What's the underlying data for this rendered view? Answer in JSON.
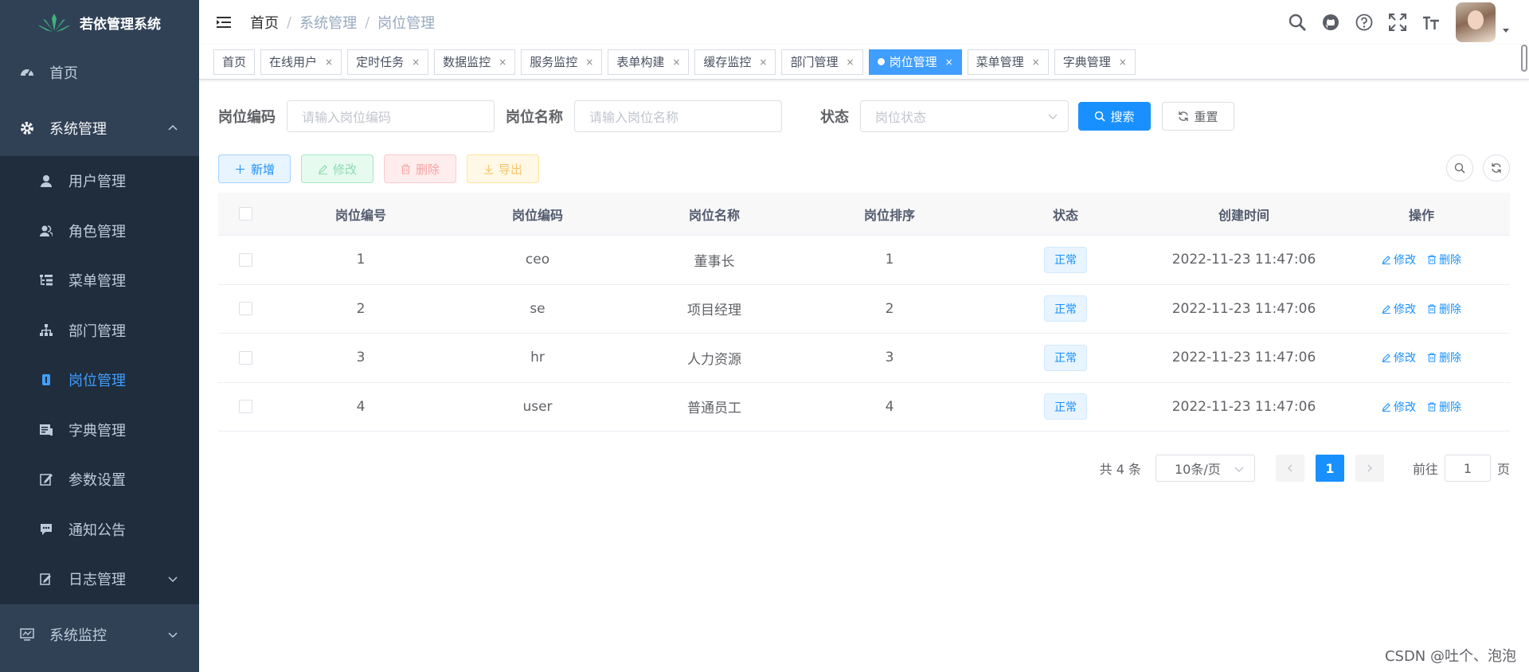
{
  "app": {
    "title": "若依管理系统"
  },
  "sidebar": {
    "items": [
      {
        "label": "首页",
        "icon": "dashboard-icon"
      },
      {
        "label": "系统管理",
        "icon": "system-gear-icon",
        "expanded": true,
        "children": [
          {
            "label": "用户管理",
            "icon": "user-icon"
          },
          {
            "label": "角色管理",
            "icon": "peoples-icon"
          },
          {
            "label": "菜单管理",
            "icon": "tree-table-icon"
          },
          {
            "label": "部门管理",
            "icon": "tree-icon"
          },
          {
            "label": "岗位管理",
            "icon": "post-icon",
            "active": true
          },
          {
            "label": "字典管理",
            "icon": "dict-icon"
          },
          {
            "label": "参数设置",
            "icon": "edit-icon"
          },
          {
            "label": "通知公告",
            "icon": "message-icon"
          },
          {
            "label": "日志管理",
            "icon": "log-icon"
          }
        ]
      },
      {
        "label": "系统监控",
        "icon": "monitor-icon"
      }
    ]
  },
  "breadcrumb": {
    "home": "首页",
    "sep": "/",
    "level1": "系统管理",
    "level2": "岗位管理"
  },
  "tags": [
    {
      "label": "首页",
      "closable": false
    },
    {
      "label": "在线用户",
      "closable": true
    },
    {
      "label": "定时任务",
      "closable": true
    },
    {
      "label": "数据监控",
      "closable": true
    },
    {
      "label": "服务监控",
      "closable": true
    },
    {
      "label": "表单构建",
      "closable": true
    },
    {
      "label": "缓存监控",
      "closable": true
    },
    {
      "label": "部门管理",
      "closable": true
    },
    {
      "label": "岗位管理",
      "closable": true,
      "active": true
    },
    {
      "label": "菜单管理",
      "closable": true
    },
    {
      "label": "字典管理",
      "closable": true
    }
  ],
  "tag_close": "×",
  "search": {
    "post_code_label": "岗位编码",
    "post_code_placeholder": "请输入岗位编码",
    "post_name_label": "岗位名称",
    "post_name_placeholder": "请输入岗位名称",
    "status_label": "状态",
    "status_placeholder": "岗位状态",
    "search_button": "搜索",
    "reset_button": "重置"
  },
  "toolbar": {
    "add": "新增",
    "edit": "修改",
    "delete": "删除",
    "export": "导出"
  },
  "table": {
    "columns": [
      "岗位编号",
      "岗位编码",
      "岗位名称",
      "岗位排序",
      "状态",
      "创建时间",
      "操作"
    ],
    "rows": [
      {
        "id": "1",
        "code": "ceo",
        "name": "董事长",
        "sort": "1",
        "status": "正常",
        "created": "2022-11-23 11:47:06"
      },
      {
        "id": "2",
        "code": "se",
        "name": "项目经理",
        "sort": "2",
        "status": "正常",
        "created": "2022-11-23 11:47:06"
      },
      {
        "id": "3",
        "code": "hr",
        "name": "人力资源",
        "sort": "3",
        "status": "正常",
        "created": "2022-11-23 11:47:06"
      },
      {
        "id": "4",
        "code": "user",
        "name": "普通员工",
        "sort": "4",
        "status": "正常",
        "created": "2022-11-23 11:47:06"
      }
    ],
    "op_edit": "修改",
    "op_delete": "删除"
  },
  "pagination": {
    "total": "共 4 条",
    "page_size": "10条/页",
    "current_page": "1",
    "goto_prefix": "前往",
    "goto_value": "1",
    "goto_suffix": "页"
  },
  "watermark": "CSDN @吐个、泡泡",
  "colors": {
    "sidebar_bg": "#304156",
    "submenu_bg": "#1f2d3d",
    "primary": "#1890ff",
    "active_menu": "#409eff"
  }
}
